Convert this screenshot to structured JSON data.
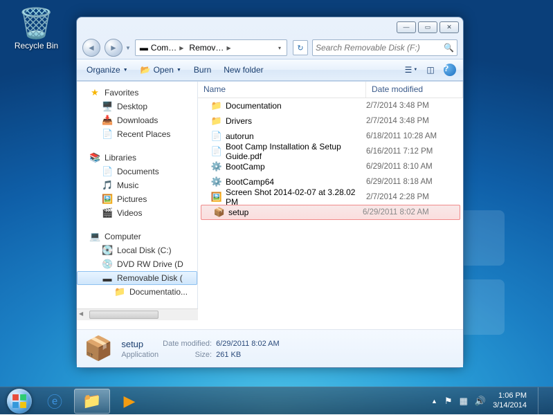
{
  "desktop": {
    "recycle_bin": "Recycle Bin"
  },
  "window": {
    "breadcrumb": [
      {
        "icon": "disk",
        "label": "Com…"
      },
      {
        "icon": "",
        "label": "Remov…"
      }
    ],
    "search_placeholder": "Search Removable Disk (F:)",
    "toolbar": {
      "organize": "Organize",
      "open": "Open",
      "burn": "Burn",
      "new_folder": "New folder"
    },
    "columns": {
      "name": "Name",
      "date": "Date modified"
    },
    "navpane": {
      "favorites": "Favorites",
      "desktop": "Desktop",
      "downloads": "Downloads",
      "recent": "Recent Places",
      "libraries": "Libraries",
      "documents": "Documents",
      "music": "Music",
      "pictures": "Pictures",
      "videos": "Videos",
      "computer": "Computer",
      "local_c": "Local Disk (C:)",
      "dvd": "DVD RW Drive (D",
      "removable": "Removable Disk (",
      "removable_child": "Documentatio..."
    },
    "files": [
      {
        "icon": "folder",
        "name": "Documentation",
        "date": "2/7/2014 3:48 PM"
      },
      {
        "icon": "folder",
        "name": "Drivers",
        "date": "2/7/2014 3:48 PM"
      },
      {
        "icon": "ini",
        "name": "autorun",
        "date": "6/18/2011 10:28 AM"
      },
      {
        "icon": "pdf",
        "name": "Boot Camp Installation & Setup Guide.pdf",
        "date": "6/16/2011 7:12 PM"
      },
      {
        "icon": "msi",
        "name": "BootCamp",
        "date": "6/29/2011 8:10 AM"
      },
      {
        "icon": "msi",
        "name": "BootCamp64",
        "date": "6/29/2011 8:18 AM"
      },
      {
        "icon": "img",
        "name": "Screen Shot 2014-02-07 at 3.28.02 PM",
        "date": "2/7/2014 2:28 PM"
      },
      {
        "icon": "exe",
        "name": "setup",
        "date": "6/29/2011 8:02 AM",
        "selected": true
      }
    ],
    "details": {
      "name": "setup",
      "type": "Application",
      "date_label": "Date modified:",
      "date": "6/29/2011 8:02 AM",
      "size_label": "Size:",
      "size": "261 KB"
    }
  },
  "taskbar": {
    "time": "1:06 PM",
    "date": "3/14/2014"
  }
}
